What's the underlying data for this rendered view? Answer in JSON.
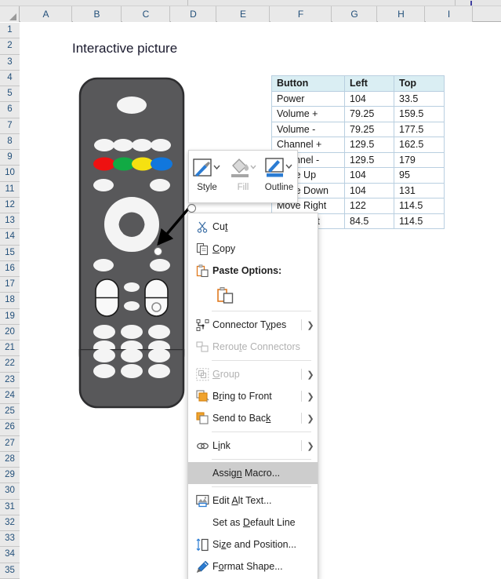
{
  "app": {
    "type": "spreadsheet",
    "columns": [
      "A",
      "B",
      "C",
      "D",
      "E",
      "F",
      "G",
      "H",
      "I"
    ],
    "rows": [
      "1",
      "2",
      "3",
      "4",
      "5",
      "6",
      "7",
      "8",
      "9",
      "10",
      "11",
      "12",
      "13",
      "14",
      "15",
      "16",
      "17",
      "18",
      "19",
      "20",
      "21",
      "22",
      "23",
      "24",
      "25",
      "26",
      "27",
      "28",
      "29",
      "30",
      "31",
      "32",
      "33",
      "34",
      "35"
    ]
  },
  "sheet": {
    "title": "Interactive picture"
  },
  "table": {
    "headers": [
      "Button",
      "Left",
      "Top"
    ],
    "rows": [
      [
        "Power",
        "104",
        "33.5"
      ],
      [
        "Volume +",
        "79.25",
        "159.5"
      ],
      [
        "Volume -",
        "79.25",
        "177.5"
      ],
      [
        "Channel +",
        "129.5",
        "162.5"
      ],
      [
        "Channel -",
        "129.5",
        "179"
      ],
      [
        "Move Up",
        "104",
        "95"
      ],
      [
        "Move Down",
        "104",
        "131"
      ],
      [
        "Move Right",
        "122",
        "114.5"
      ],
      [
        "Move Left",
        "84.5",
        "114.5"
      ]
    ]
  },
  "mini_toolbar": {
    "items": [
      {
        "label": "Style",
        "icon": "shape-style-icon",
        "disabled": false
      },
      {
        "label": "Fill",
        "icon": "fill-bucket-icon",
        "disabled": true
      },
      {
        "label": "Outline",
        "icon": "outline-pen-icon",
        "disabled": false
      }
    ]
  },
  "context_menu": {
    "items": [
      {
        "label": "Cut",
        "icon": "scissors-icon",
        "accel": "t",
        "submenu": false,
        "disabled": false,
        "highlighted": false,
        "bold": false
      },
      {
        "label": "Copy",
        "icon": "copy-icon",
        "accel": "C",
        "submenu": false,
        "disabled": false,
        "highlighted": false,
        "bold": false
      },
      {
        "label": "Paste Options:",
        "icon": "clipboard-icon",
        "accel": "",
        "submenu": false,
        "disabled": false,
        "highlighted": false,
        "bold": true
      },
      {
        "label": "Connector Types",
        "icon": "connector-types-icon",
        "accel": "y",
        "submenu": true,
        "disabled": false,
        "highlighted": false,
        "bold": false
      },
      {
        "label": "Reroute Connectors",
        "icon": "reroute-connectors-icon",
        "accel": "t",
        "submenu": false,
        "disabled": true,
        "highlighted": false,
        "bold": false
      },
      {
        "label": "Group",
        "icon": "group-icon",
        "accel": "G",
        "submenu": true,
        "disabled": true,
        "highlighted": false,
        "bold": false
      },
      {
        "label": "Bring to Front",
        "icon": "bring-to-front-icon",
        "accel": "r",
        "submenu": true,
        "disabled": false,
        "highlighted": false,
        "bold": false
      },
      {
        "label": "Send to Back",
        "icon": "send-to-back-icon",
        "accel": "k",
        "submenu": true,
        "disabled": false,
        "highlighted": false,
        "bold": false
      },
      {
        "label": "Link",
        "icon": "link-icon",
        "accel": "i",
        "submenu": true,
        "disabled": false,
        "highlighted": false,
        "bold": false
      },
      {
        "label": "Assign Macro...",
        "icon": "none",
        "accel": "n",
        "submenu": false,
        "disabled": false,
        "highlighted": true,
        "bold": false
      },
      {
        "label": "Edit Alt Text...",
        "icon": "alt-text-icon",
        "accel": "A",
        "submenu": false,
        "disabled": false,
        "highlighted": false,
        "bold": false
      },
      {
        "label": "Set as Default Line",
        "icon": "none",
        "accel": "D",
        "submenu": false,
        "disabled": false,
        "highlighted": false,
        "bold": false
      },
      {
        "label": "Size and Position...",
        "icon": "size-position-icon",
        "accel": "z",
        "submenu": false,
        "disabled": false,
        "highlighted": false,
        "bold": false
      },
      {
        "label": "Format Shape...",
        "icon": "format-shape-icon",
        "accel": "o",
        "submenu": false,
        "disabled": false,
        "highlighted": false,
        "bold": false
      }
    ],
    "paste_option_icon": "paste-keep-source-icon"
  },
  "picture": {
    "name": "remote-control-image",
    "body_color": "#58585a",
    "button_color": "#f2f2f2",
    "color_buttons": [
      "#ee1111",
      "#11aa44",
      "#f5e111",
      "#1177dd"
    ]
  },
  "colors": {
    "header_fill": "#daeef3",
    "header_text": "#23507a",
    "grid_chrome": "#e9e9e9",
    "menu_highlight": "#cdcdcd"
  }
}
